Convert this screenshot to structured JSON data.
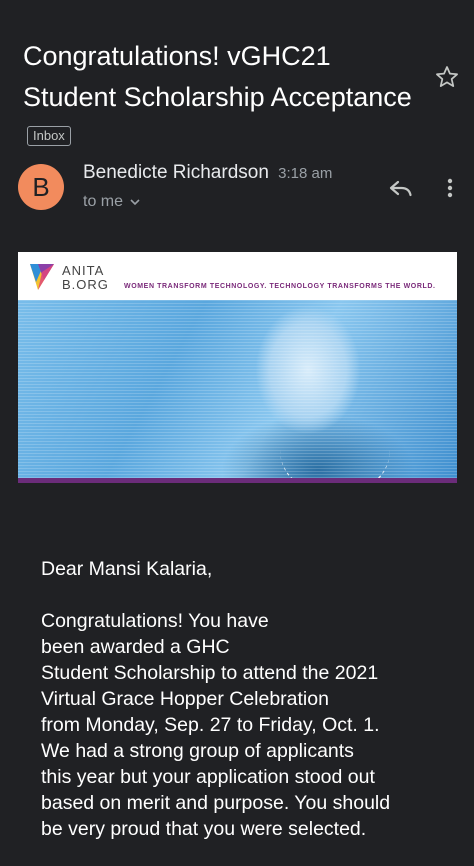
{
  "email": {
    "subject": "Congratulations! vGHC21 Student Scholarship Acceptance",
    "label": "Inbox",
    "sender": "Benedicte Richardson",
    "time": "3:18 am",
    "recipient": "to me"
  },
  "banner": {
    "logo_line1": "ANITA",
    "logo_line2": "B.ORG",
    "tagline": "WOMEN TRANSFORM TECHNOLOGY. TECHNOLOGY TRANSFORMS THE WORLD."
  },
  "body": {
    "greeting": "Dear Mansi Kalaria,",
    "lines": [
      "Congratulations! You have",
      "been awarded a GHC",
      "Student Scholarship to attend the 2021",
      "Virtual Grace Hopper Celebration",
      "from Monday, Sep. 27 to Friday, Oct. 1.",
      "We had a strong group of applicants",
      "this year but your application stood out",
      "based on merit and purpose. You should",
      "be very proud that you were selected."
    ]
  },
  "icons": {
    "star": "star-outline-icon",
    "reply": "reply-icon",
    "more": "more-vert-icon",
    "expand": "chevron-down-icon"
  },
  "colors": {
    "background": "#202124",
    "avatar": "#f28b5d",
    "brand_bar": "#6b2c7a"
  }
}
